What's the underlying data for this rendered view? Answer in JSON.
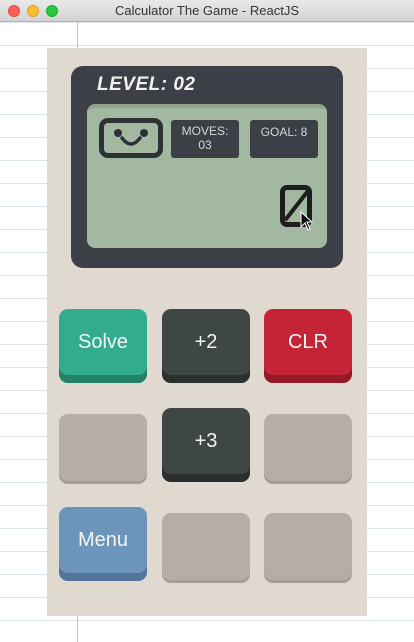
{
  "window": {
    "title": "Calculator The Game - ReactJS"
  },
  "screen": {
    "level_label": "LEVEL: 02",
    "moves_label": "MOVES:",
    "moves_value": "03",
    "goal_label": "GOAL: 8",
    "display_value": "0"
  },
  "buttons": {
    "solve": "Solve",
    "plus2": "+2",
    "clr": "CLR",
    "plus3": "+3",
    "menu": "Menu"
  },
  "icons": {
    "face": "smiley-face-icon",
    "cursor": "mouse-pointer-icon"
  },
  "colors": {
    "solve": "#31ad8e",
    "operator": "#3f4744",
    "clear": "#c42436",
    "menu": "#6d94ba",
    "lcd": "#a3b8a0",
    "body": "#e0d9cf"
  }
}
